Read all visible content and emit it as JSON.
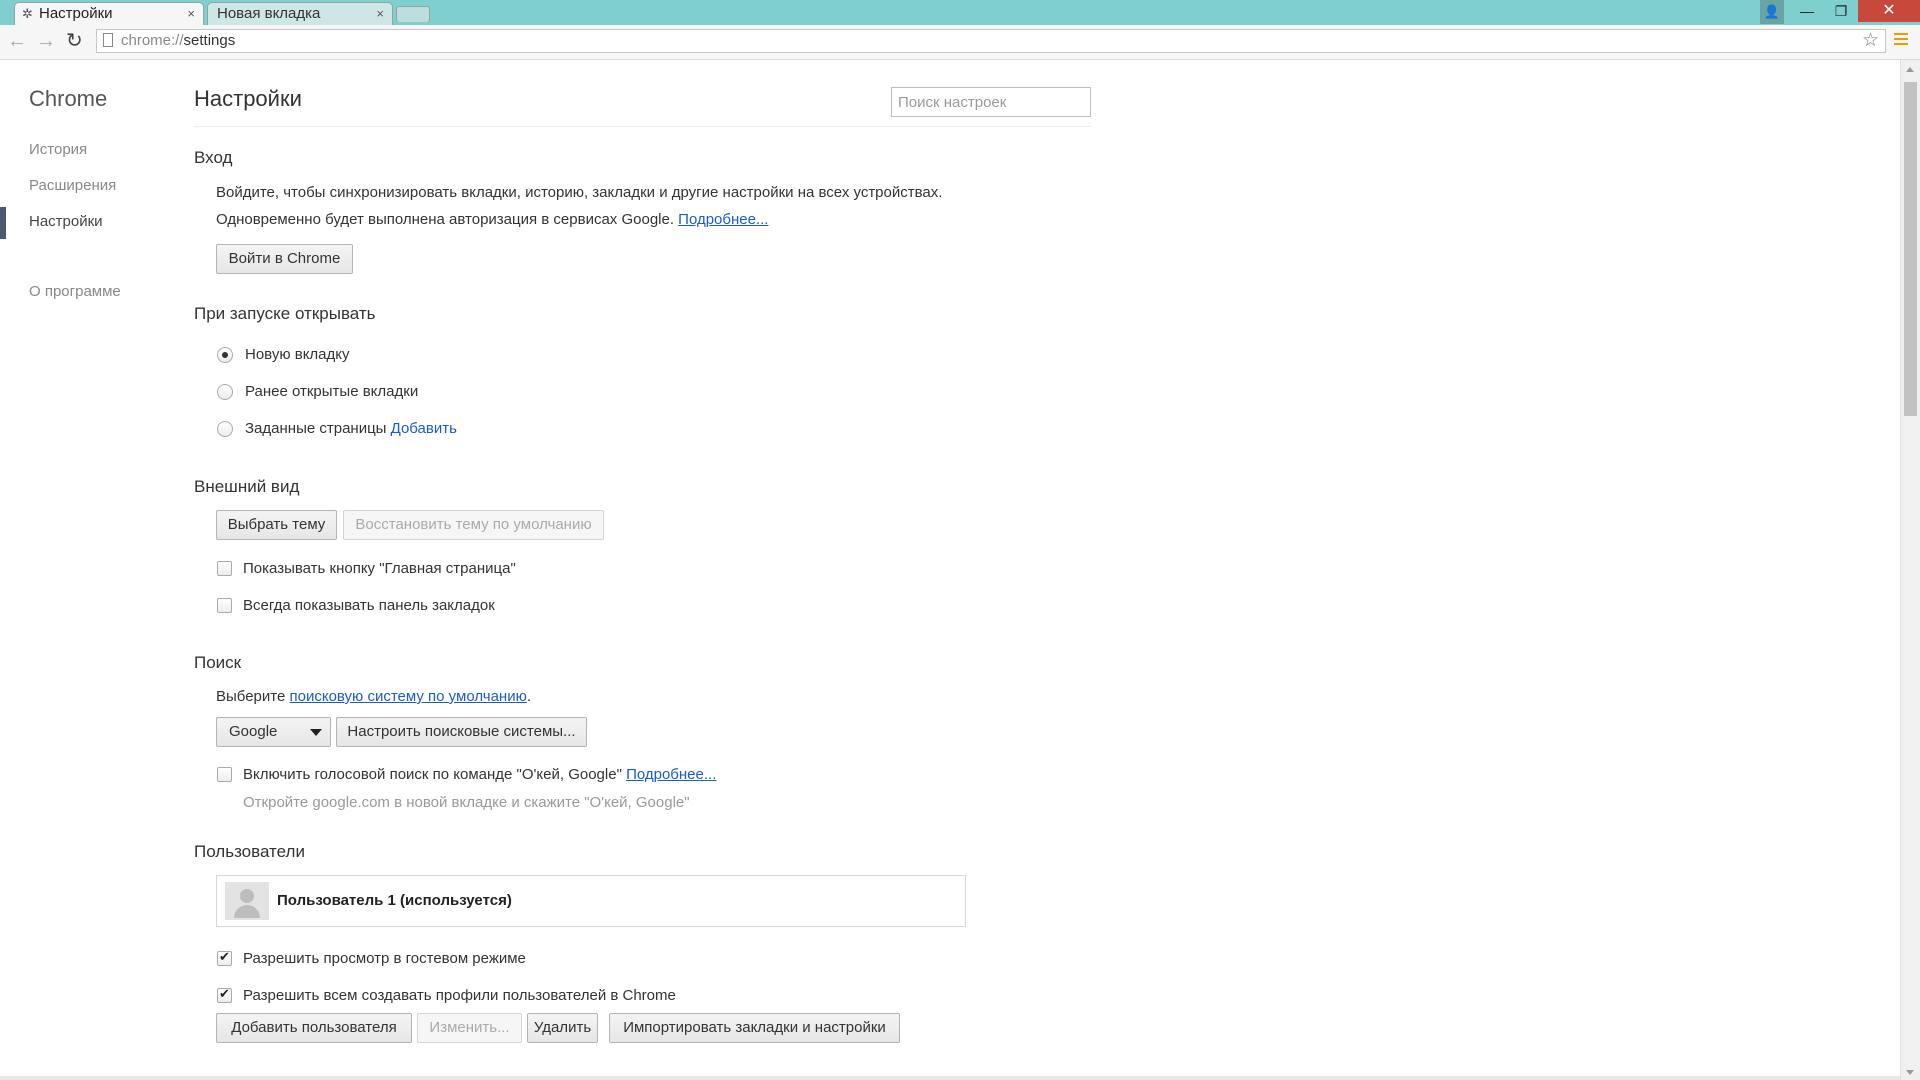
{
  "browser": {
    "tabs": [
      {
        "title": "Настройки"
      },
      {
        "title": "Новая вкладка"
      }
    ],
    "close_glyph": "×",
    "url_scheme": "chrome://",
    "url_path": "settings"
  },
  "nav": {
    "title": "Chrome",
    "items": [
      {
        "label": "История"
      },
      {
        "label": "Расширения"
      },
      {
        "label": "Настройки"
      },
      {
        "label": "О программе"
      }
    ],
    "active": "Настройки"
  },
  "header": {
    "title": "Настройки",
    "search_placeholder": "Поиск настроек"
  },
  "signin": {
    "title": "Вход",
    "line1": "Войдите, чтобы синхронизировать вкладки, историю, закладки и другие настройки на всех устройствах.",
    "line2": "Одновременно будет выполнена авторизация в сервисах Google.",
    "more_link": "Подробнее...",
    "button": "Войти в Chrome"
  },
  "startup": {
    "title": "При запуске открывать",
    "options": [
      {
        "label": "Новую вкладку",
        "checked": true
      },
      {
        "label": "Ранее открытые вкладки",
        "checked": false
      },
      {
        "label": "Заданные страницы",
        "checked": false
      }
    ],
    "add_link": "Добавить"
  },
  "appearance": {
    "title": "Внешний вид",
    "choose_theme": "Выбрать тему",
    "reset_theme": "Восстановить тему по умолчанию",
    "show_home": "Показывать кнопку \"Главная страница\"",
    "show_bookmarks": "Всегда показывать панель закладок"
  },
  "search": {
    "title": "Поиск",
    "prefix": "Выберите",
    "engine_link": "поисковую систему по умолчанию",
    "suffix": ".",
    "engine_value": "Google",
    "manage_button": "Настроить поисковые системы...",
    "voice_label": "Включить голосовой поиск по команде \"О'кей, Google\"",
    "voice_more": "Подробнее...",
    "voice_hint": "Откройте google.com в новой вкладке и скажите \"О'кей, Google\""
  },
  "users": {
    "title": "Пользователи",
    "current_user": "Пользователь 1 (используется)",
    "guest": {
      "label": "Разрешить просмотр в гостевом режиме",
      "checked": true
    },
    "anyone_add": {
      "label": "Разрешить всем создавать профили пользователей в Chrome",
      "checked": true
    },
    "buttons": {
      "add": "Добавить пользователя",
      "edit": "Изменить...",
      "delete": "Удалить",
      "import": "Импортировать закладки и настройки"
    }
  },
  "colors": {
    "titlebar": "#7fcfcf",
    "link": "#1a5bd0",
    "close_button": "#c9483c",
    "menu_icon": "#e8a000"
  }
}
